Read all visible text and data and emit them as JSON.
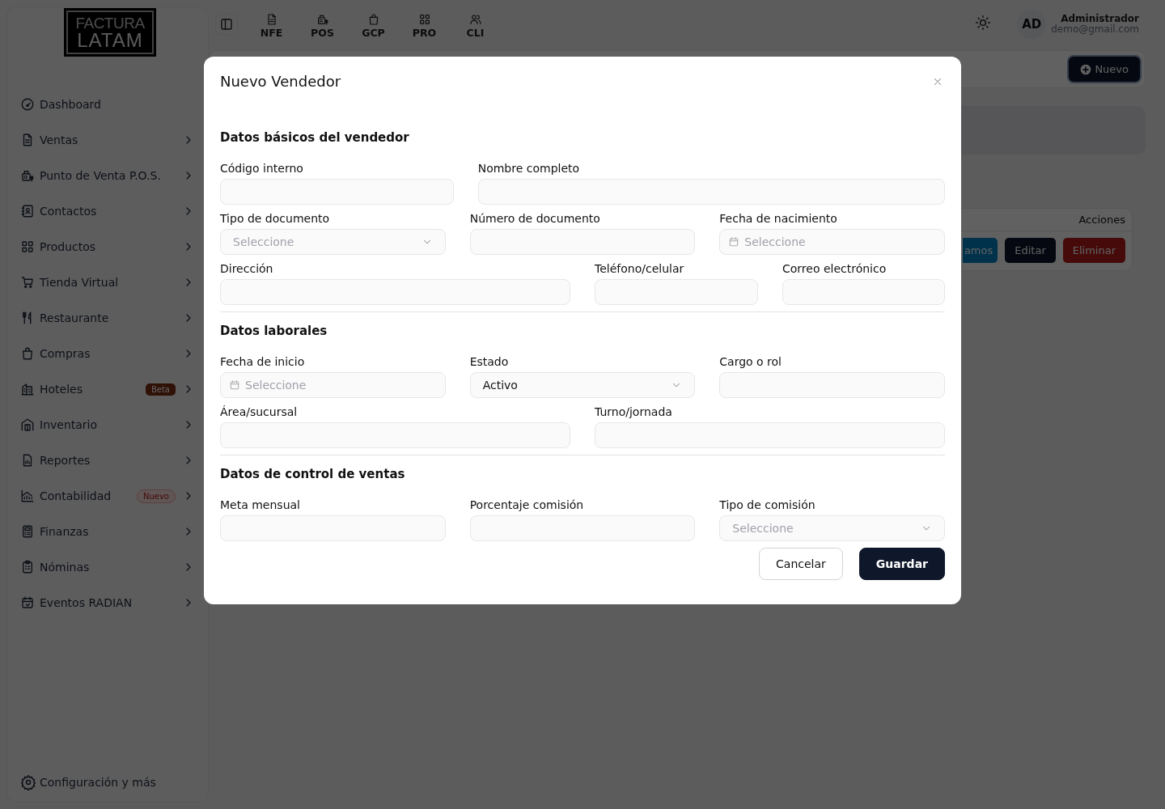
{
  "sidebar": {
    "logo": {
      "line1": "FACTURA",
      "line2": "LATAM"
    },
    "items": [
      {
        "label": "Dashboard",
        "expandable": false
      },
      {
        "label": "Ventas",
        "expandable": true
      },
      {
        "label": "Punto de Venta P.O.S.",
        "expandable": true
      },
      {
        "label": "Contactos",
        "expandable": true
      },
      {
        "label": "Productos",
        "expandable": true
      },
      {
        "label": "Tienda Virtual",
        "expandable": true
      },
      {
        "label": "Restaurante",
        "expandable": true
      },
      {
        "label": "Compras",
        "expandable": true
      },
      {
        "label": "Hoteles",
        "expandable": true,
        "badge": {
          "text": "Beta",
          "kind": "beta"
        }
      },
      {
        "label": "Inventario",
        "expandable": true
      },
      {
        "label": "Reportes",
        "expandable": true
      },
      {
        "label": "Contabilidad",
        "expandable": true,
        "badge": {
          "text": "Nuevo",
          "kind": "new"
        }
      },
      {
        "label": "Finanzas",
        "expandable": true
      },
      {
        "label": "Nóminas",
        "expandable": true
      },
      {
        "label": "Eventos RADIAN",
        "expandable": true
      }
    ],
    "footer": "Configuración y más"
  },
  "topbar": {
    "shortcuts": [
      "NFE",
      "POS",
      "GCP",
      "PRO",
      "CLI"
    ],
    "user": {
      "initials": "AD",
      "name": "Administrador",
      "email": "demo@gmail.com"
    }
  },
  "main": {
    "new_button": "Nuevo",
    "table": {
      "columns": [
        "Acciones"
      ],
      "row_actions": [
        "amos",
        "Editar",
        "Eliminar"
      ]
    }
  },
  "modal": {
    "title": "Nuevo Vendedor",
    "sections": [
      {
        "title": "Datos básicos del vendedor",
        "rows": [
          [
            {
              "label": "Código interno",
              "kind": "text"
            },
            {
              "label": "Nombre completo",
              "kind": "text"
            }
          ],
          [
            {
              "label": "Tipo de documento",
              "kind": "select",
              "placeholder": "Seleccione"
            },
            {
              "label": "Número de documento",
              "kind": "text"
            },
            {
              "label": "Fecha de nacimiento",
              "kind": "date",
              "placeholder": "Seleccione"
            }
          ],
          [
            {
              "label": "Dirección",
              "kind": "text"
            },
            {
              "label": "Teléfono/celular",
              "kind": "text"
            },
            {
              "label": "Correo electrónico",
              "kind": "text"
            }
          ]
        ]
      },
      {
        "title": "Datos laborales",
        "rows": [
          [
            {
              "label": "Fecha de inicio",
              "kind": "date",
              "placeholder": "Seleccione"
            },
            {
              "label": "Estado",
              "kind": "select",
              "value": "Activo"
            },
            {
              "label": "Cargo o rol",
              "kind": "text"
            }
          ],
          [
            {
              "label": "Área/sucursal",
              "kind": "text"
            },
            {
              "label": "Turno/jornada",
              "kind": "text"
            }
          ]
        ]
      },
      {
        "title": "Datos de control de ventas",
        "rows": [
          [
            {
              "label": "Meta mensual",
              "kind": "text"
            },
            {
              "label": "Porcentaje comisión",
              "kind": "text"
            },
            {
              "label": "Tipo de comisión",
              "kind": "select",
              "placeholder": "Seleccione"
            }
          ]
        ]
      }
    ],
    "buttons": [
      {
        "label": "Cancelar",
        "kind": "secondary"
      },
      {
        "label": "Guardar",
        "kind": "primary"
      }
    ]
  }
}
